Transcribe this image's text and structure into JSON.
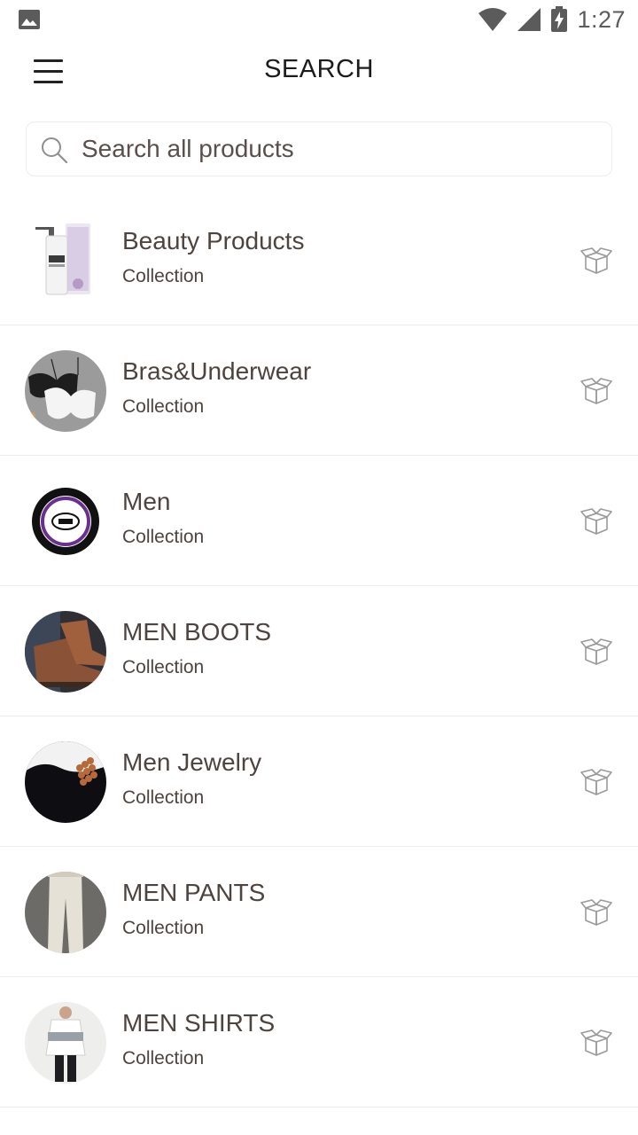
{
  "status_bar": {
    "time": "1:27",
    "icons": [
      "image-icon",
      "wifi-icon",
      "cell-signal-icon",
      "battery-charging-icon"
    ]
  },
  "header": {
    "title": "SEARCH",
    "menu_icon": "hamburger-menu-icon"
  },
  "search": {
    "placeholder": "Search all products",
    "value": "",
    "icon": "search-icon"
  },
  "collections": [
    {
      "title": "Beauty Products",
      "subtitle": "Collection",
      "thumb": "beauty-spray-bottle",
      "action_icon": "open-box-icon"
    },
    {
      "title": "Bras&Underwear",
      "subtitle": "Collection",
      "thumb": "bras-photo",
      "action_icon": "open-box-icon"
    },
    {
      "title": "Men",
      "subtitle": "Collection",
      "thumb": "bazar-fashion-logo",
      "action_icon": "open-box-icon"
    },
    {
      "title": "MEN BOOTS",
      "subtitle": "Collection",
      "thumb": "boots-photo",
      "action_icon": "open-box-icon"
    },
    {
      "title": "Men Jewelry",
      "subtitle": "Collection",
      "thumb": "bead-bracelet-photo",
      "action_icon": "open-box-icon"
    },
    {
      "title": "MEN PANTS",
      "subtitle": "Collection",
      "thumb": "pants-photo",
      "action_icon": "open-box-icon"
    },
    {
      "title": "MEN SHIRTS",
      "subtitle": "Collection",
      "thumb": "shirt-photo",
      "action_icon": "open-box-icon"
    }
  ],
  "colors": {
    "text": "#4d433f",
    "divider": "#ececec",
    "title": "#1c1c1c",
    "icon": "#9a9a9a"
  }
}
